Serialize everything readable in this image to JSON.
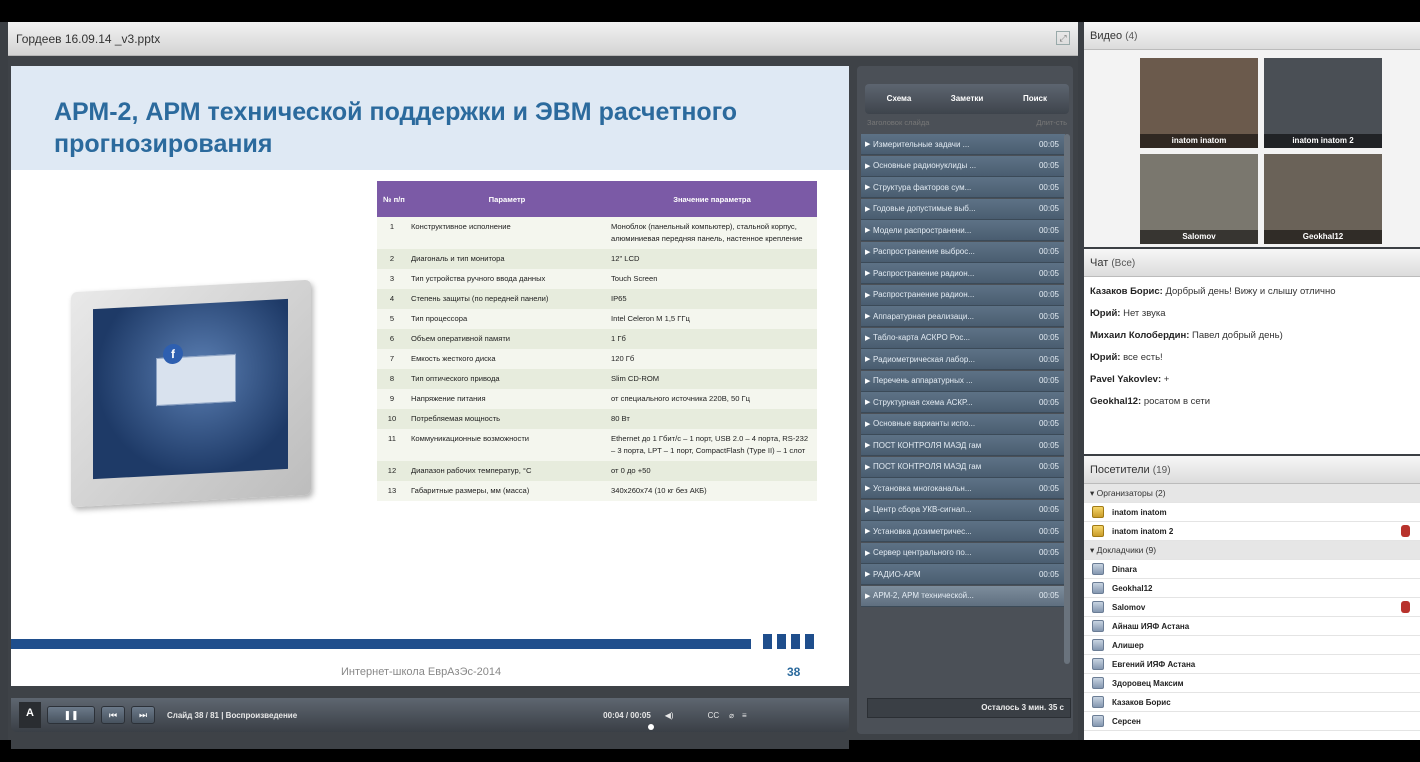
{
  "share_pod": {
    "title": "Гордеев 16.09.14 _v3.pptx"
  },
  "slide": {
    "title": "АРМ-2, АРМ технической поддержки и ЭВМ расчетного прогнозирования",
    "table_headers": [
      "№ п/п",
      "Параметр",
      "Значение параметра"
    ],
    "table_rows": [
      [
        "1",
        "Конструктивное исполнение",
        "Моноблок (панельный компьютер), стальной корпус, алюминиевая передняя панель, настенное крепление"
      ],
      [
        "2",
        "Диагональ и тип монитора",
        "12\" LCD"
      ],
      [
        "3",
        "Тип устройства ручного ввода данных",
        "Touch Screen"
      ],
      [
        "4",
        "Степень защиты (по передней панели)",
        "IP65"
      ],
      [
        "5",
        "Тип процессора",
        "Intel Celeron M 1,5 ГГц"
      ],
      [
        "6",
        "Объем оперативной памяти",
        "1 Гб"
      ],
      [
        "7",
        "Емкость жесткого диска",
        "120 Гб"
      ],
      [
        "8",
        "Тип оптического привода",
        "Slim CD-ROM"
      ],
      [
        "9",
        "Напряжение питания",
        "от специального источника 220В, 50 Гц"
      ],
      [
        "10",
        "Потребляемая мощность",
        "80 Вт"
      ],
      [
        "11",
        "Коммуникационные возможности",
        "Ethernet до 1 Гбит/с – 1 порт, USB 2.0 – 4 порта, RS-232 – 3 порта, LPT – 1 порт, CompactFlash (Type II) – 1 слот"
      ],
      [
        "12",
        "Диапазон рабочих температур, °С",
        "от 0 до +50"
      ],
      [
        "13",
        "Габаритные размеры, мм (масса)",
        "340x260x74 (10 кг без АКБ)"
      ]
    ],
    "footer": "Интернет-школа ЕврАзЭс-2014",
    "page": "38"
  },
  "player": {
    "adobe_label": "A",
    "slide_status": "Слайд 38 / 81 | Воспроизведение",
    "time": "00:04 / 00:05",
    "cc_label": "CC"
  },
  "outline": {
    "tabs": [
      "Схема",
      "Заметки",
      "Поиск"
    ],
    "col_title": "Заголовок слайда",
    "col_duration": "Длит-сть",
    "items": [
      {
        "title": "Измерительные задачи ...",
        "dur": "00:05"
      },
      {
        "title": "Основные радионуклиды ...",
        "dur": "00:05"
      },
      {
        "title": "Структура факторов сум...",
        "dur": "00:05"
      },
      {
        "title": "Годовые допустимые выб...",
        "dur": "00:05"
      },
      {
        "title": "Модели распространени...",
        "dur": "00:05"
      },
      {
        "title": "Распространение выброс...",
        "dur": "00:05"
      },
      {
        "title": "Распространение радион...",
        "dur": "00:05"
      },
      {
        "title": "Распространение радион...",
        "dur": "00:05"
      },
      {
        "title": "Аппаратурная реализаци...",
        "dur": "00:05"
      },
      {
        "title": "Табло-карта АСКРО Рос...",
        "dur": "00:05"
      },
      {
        "title": "Радиометрическая лабор...",
        "dur": "00:05"
      },
      {
        "title": "Перечень аппаратурных ...",
        "dur": "00:05"
      },
      {
        "title": "Структурная схема АСКР...",
        "dur": "00:05"
      },
      {
        "title": "Основные варианты испо...",
        "dur": "00:05"
      },
      {
        "title": "ПОСТ КОНТРОЛЯ МАЭД гам",
        "dur": "00:05"
      },
      {
        "title": "ПОСТ КОНТРОЛЯ МАЭД гам",
        "dur": "00:05"
      },
      {
        "title": "Установка многоканальн...",
        "dur": "00:05"
      },
      {
        "title": "Центр сбора УКВ-сигнал...",
        "dur": "00:05"
      },
      {
        "title": "Установка дозиметричес...",
        "dur": "00:05"
      },
      {
        "title": "Сервер центрального по...",
        "dur": "00:05"
      },
      {
        "title": "РАДИО-АРМ",
        "dur": "00:05"
      },
      {
        "title": "АРМ-2, АРМ технической...",
        "dur": "00:05"
      }
    ],
    "remaining": "Осталось 3 мин. 35 с"
  },
  "video": {
    "title": "Видео",
    "count": "(4)",
    "tiles": [
      {
        "name": "inatom inatom",
        "color": "#6b5a4c"
      },
      {
        "name": "inatom inatom 2",
        "color": "#4a4f55"
      },
      {
        "name": "Salomov",
        "color": "#7a776e"
      },
      {
        "name": "Geokhal12",
        "color": "#6a6258"
      }
    ]
  },
  "chat": {
    "title": "Чат",
    "scope": "(Все)",
    "messages": [
      {
        "from": "Казаков Борис:",
        "text": "Дорбрый день! Вижу и слышу отлично"
      },
      {
        "from": "Юрий:",
        "text": "Нет звука"
      },
      {
        "from": "Михаил Колобердин:",
        "text": "Павел добрый день)"
      },
      {
        "from": "Юрий:",
        "text": "все есть!"
      },
      {
        "from": "Pavel Yakovlev:",
        "text": "+"
      },
      {
        "from": "Geokhal12:",
        "text": "росатом в сети"
      }
    ]
  },
  "attendees": {
    "title": "Посетители",
    "count": "(19)",
    "organizers_label": "▾ Организаторы (2)",
    "organizers": [
      "inatom inatom",
      "inatom inatom 2"
    ],
    "presenters_label": "▾ Докладчики (9)",
    "presenters": [
      "Dinara",
      "Geokhal12",
      "Salomov",
      "Айнаш ИЯФ Астана",
      "Алишер",
      "Евгений ИЯФ Астана",
      "Здоровец Максим",
      "Казаков Борис",
      "Серсен"
    ]
  }
}
